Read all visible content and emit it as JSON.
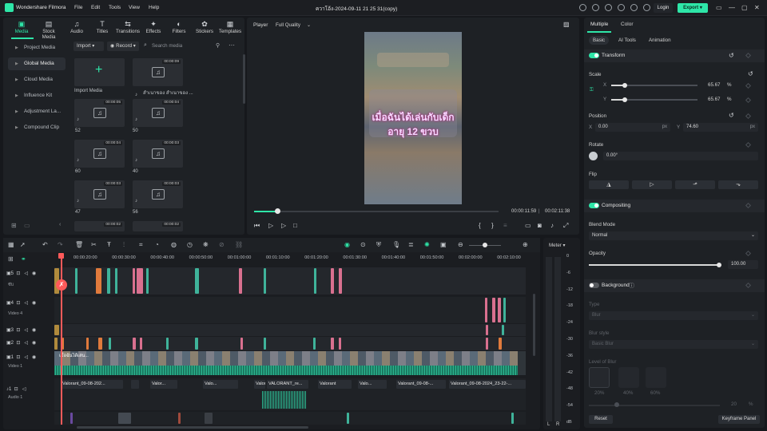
{
  "app": {
    "name": "Wondershare Filmora",
    "doc_title": "ควาโอ้ง-2024-09-11 21 25 31(copy)"
  },
  "menu": [
    "File",
    "Edit",
    "Tools",
    "View",
    "Help"
  ],
  "top_actions": {
    "login": "Login",
    "export": "Export ▾"
  },
  "media_tabs": [
    "Media",
    "Stock Media",
    "Audio",
    "Titles",
    "Transitions",
    "Effects",
    "Filters",
    "Stickers",
    "Templates"
  ],
  "sidebar": [
    "Project Media",
    "Global Media",
    "Cloud Media",
    "Influence Kit",
    "Adjustment La...",
    "Compound Clip"
  ],
  "media_toolbar": {
    "import": "Import ▾",
    "record": "Record ▾",
    "search_placeholder": "Search media"
  },
  "media_items": [
    {
      "label": "Import Media",
      "duration": ""
    },
    {
      "label": "สำเนาของ สำเนาของ ...",
      "duration": "00:00:09"
    },
    {
      "label": "52",
      "duration": "00:00:05"
    },
    {
      "label": "50",
      "duration": "00:00:04"
    },
    {
      "label": "60",
      "duration": "00:00:04"
    },
    {
      "label": "40",
      "duration": "00:00:03"
    },
    {
      "label": "47",
      "duration": "00:00:03"
    },
    {
      "label": "56",
      "duration": "00:00:03"
    },
    {
      "label": "",
      "duration": "00:00:02"
    },
    {
      "label": "",
      "duration": "00:00:02"
    }
  ],
  "player": {
    "label": "Player",
    "quality": "Full Quality",
    "subtitle_line1": "เมื่อฉันได้เล่นกับเด็ก",
    "subtitle_line2": "อายุ 12 ขวบ",
    "current_time": "00:00:11:59",
    "total_time": "00:02:11:38",
    "progress_fraction": 0.1
  },
  "right_tabs": {
    "multiple": "Multiple",
    "color": "Color",
    "basic": "Basic",
    "ai_tools": "AI Tools",
    "animation": "Animation"
  },
  "transform": {
    "title": "Transform",
    "scale_label": "Scale",
    "x_label": "X",
    "y_label": "Y",
    "scale_x": "65.67",
    "scale_y": "65.67",
    "pct": "%",
    "position_label": "Position",
    "pos_x": "0.00",
    "pos_y": "74.60",
    "px": "px",
    "rotate_label": "Rotate",
    "rotate": "0.00°",
    "flip_label": "Flip"
  },
  "compositing": {
    "title": "Compositing",
    "blend_label": "Blend Mode",
    "blend_value": "Normal",
    "opacity_label": "Opacity",
    "opacity_value": "100.00"
  },
  "background": {
    "title": "Background",
    "type_label": "Type",
    "type_value": "Blur",
    "style_label": "Blur style",
    "style_value": "Basic Blur",
    "level_label": "Level of Blur",
    "level_options": [
      "20%",
      "40%",
      "60%"
    ],
    "level_value": "20",
    "level_pct": "%"
  },
  "bottom": {
    "reset": "Reset",
    "keyframe_panel": "Keyframe Panel"
  },
  "timeline": {
    "ruler": [
      "00:00:20:00",
      "00:00:30:00",
      "00:00:40:00",
      "00:00:50:00",
      "00:01:00:00",
      "00:01:10:00",
      "00:01:20:00",
      "00:01:30:00",
      "00:01:40:00",
      "00:01:50:00",
      "00:02:00:00",
      "00:02:10:00"
    ],
    "track_heads": [
      {
        "num": "5",
        "name": "ซับ"
      },
      {
        "num": "4",
        "name": "Video 4"
      },
      {
        "num": "3",
        "name": ""
      },
      {
        "num": "2",
        "name": ""
      },
      {
        "num": "1",
        "name": "Video 1"
      },
      {
        "num": "1",
        "name": "Audio 1"
      }
    ],
    "video_clip_label": "เมื่อฉันได้เล่น...",
    "audio_clips": [
      "Valorant_09-08-202...",
      "Valor...",
      "Valo...",
      "Valorant_0...",
      "VALORANT_re...",
      "Valorant",
      "Valo...",
      "Valorant_09-08-...",
      "Valorant_09-08-2024_23-22-..."
    ]
  },
  "meter": {
    "label": "Meter ▾",
    "ticks": [
      "0",
      "-6",
      "-12",
      "-18",
      "-24",
      "-30",
      "-36",
      "-42",
      "-48",
      "-54",
      "dB"
    ],
    "left": "L",
    "right": "R"
  },
  "colors": {
    "accent": "#2ee6a8",
    "pink_clip": "#d9708f",
    "orange_clip": "#e07a3c",
    "teal_clip": "#3fb39a",
    "playhead": "#ff5a5a"
  }
}
